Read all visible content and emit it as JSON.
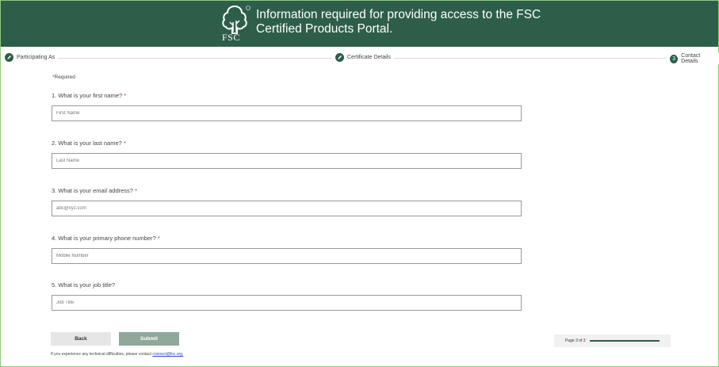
{
  "header": {
    "title": "Information required for providing access to the FSC Certified Products Portal.",
    "logo_text": "FSC",
    "logo_mark": "®"
  },
  "progress": {
    "steps": [
      {
        "label": "Participating As",
        "state": "done",
        "icon": "pencil-icon"
      },
      {
        "label": "Certificate Details",
        "state": "done",
        "icon": "pencil-icon"
      },
      {
        "label": "Contact Details",
        "state": "current",
        "number": "3"
      }
    ]
  },
  "form": {
    "required_star": "*",
    "required_note": "Required",
    "questions": [
      {
        "label": "1. What is your first name?",
        "required": "*",
        "placeholder": "First Name"
      },
      {
        "label": "2. What is your last name?",
        "required": "*",
        "placeholder": "Last Name"
      },
      {
        "label": "3. What is your email address?",
        "required": "*",
        "placeholder": "abc@xyz.com"
      },
      {
        "label": "4. What is your primary phone number?",
        "required": "*",
        "placeholder": "Mobile Number"
      },
      {
        "label": "5. What is your job title?",
        "required": "",
        "placeholder": "Job Title"
      }
    ]
  },
  "buttons": {
    "back": "Back",
    "submit": "Submit"
  },
  "footer": {
    "note": "If you experience any technical difficulties, please contact ",
    "email": "connect@fsc.org."
  },
  "pagination": {
    "text": "Page 3 of 3",
    "progress_fraction": 1.0
  },
  "colors": {
    "brand": "#2d5e4a",
    "required": "#c0392b",
    "submit_disabled": "#8fa89a"
  }
}
